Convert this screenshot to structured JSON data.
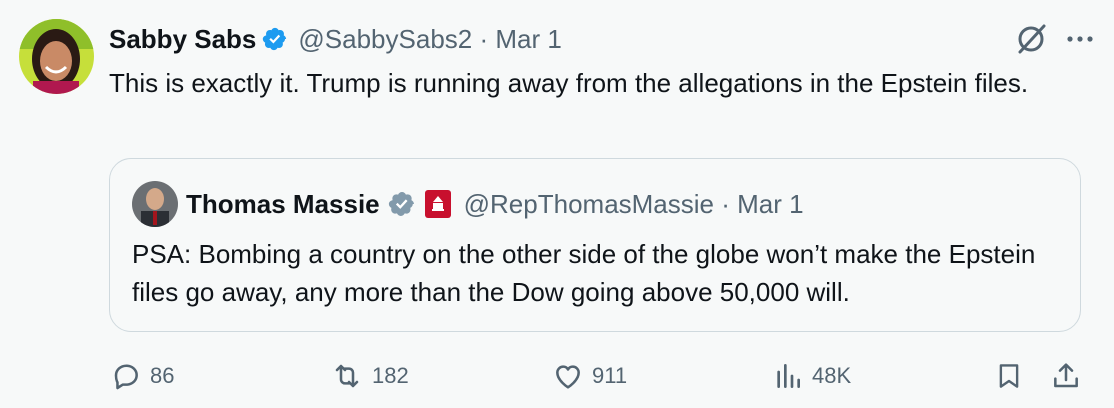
{
  "tweet": {
    "display_name": "Sabby Sabs",
    "handle_date": "@SabbySabs2 · Mar 1",
    "text": "This is exactly it. Trump is running away from the allegations in the Epstein files."
  },
  "quote": {
    "display_name": "Thomas Massie",
    "handle_date": "@RepThomasMassie · Mar 1",
    "text": "PSA: Bombing a country on the other side of the globe won’t make the Epstein files go away, any more than the Dow going above 50,000 will."
  },
  "actions": {
    "replies": "86",
    "reposts": "182",
    "likes": "911",
    "views": "48K"
  },
  "colors": {
    "verified_blue": "#1d9bf0",
    "verified_gray": "#829aab",
    "muted": "#536471",
    "border": "#cfd9de",
    "gov_red": "#c8102e"
  },
  "icons": [
    "verified-badge-icon",
    "grok-icon",
    "more-icon",
    "reply-icon",
    "repost-icon",
    "like-icon",
    "views-icon",
    "bookmark-icon",
    "share-icon",
    "gov-badge-icon"
  ]
}
